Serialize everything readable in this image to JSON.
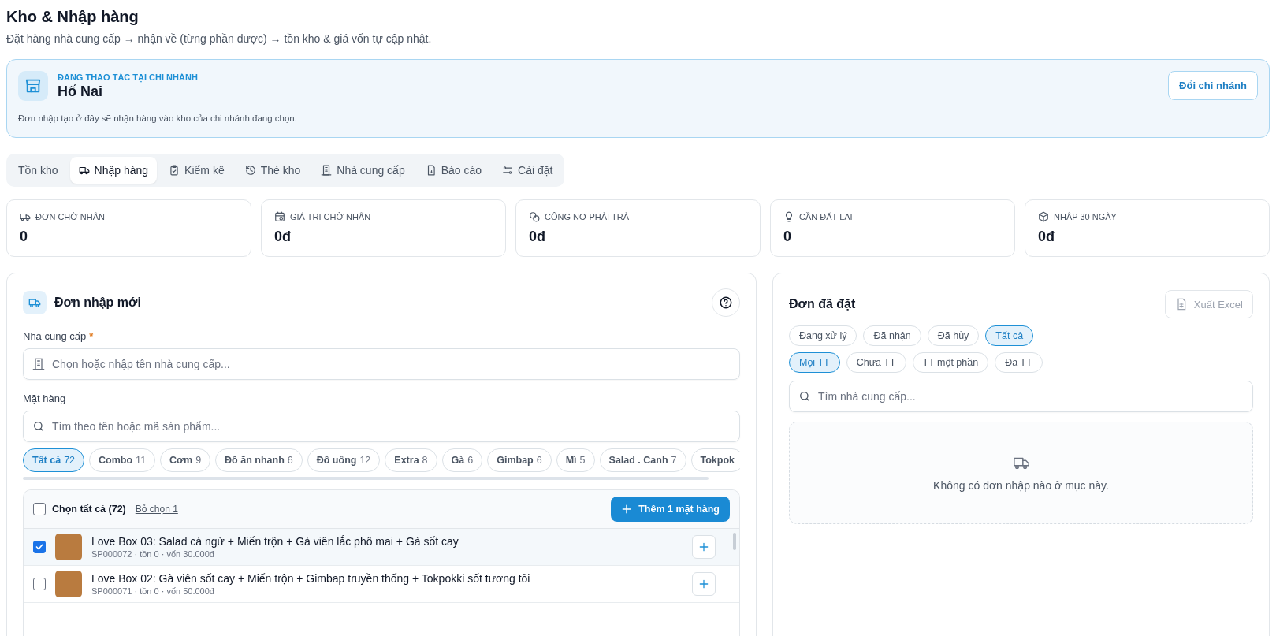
{
  "page": {
    "title": "Kho & Nhập hàng",
    "subtitle": "Đặt hàng nhà cung cấp → nhận về (từng phần được) → tồn kho & giá vốn tự cập nhật."
  },
  "branch": {
    "label": "ĐANG THAO TÁC TẠI CHI NHÁNH",
    "name": "Hố Nai",
    "note": "Đơn nhập tạo ở đây sẽ nhận hàng vào kho của chi nhánh đang chọn.",
    "button": "Đổi chi nhánh"
  },
  "tabs": [
    {
      "label": "Tồn kho",
      "selected": false
    },
    {
      "label": "Nhập hàng",
      "selected": true
    },
    {
      "label": "Kiểm kê",
      "selected": false
    },
    {
      "label": "Thẻ kho",
      "selected": false
    },
    {
      "label": "Nhà cung cấp",
      "selected": false
    },
    {
      "label": "Báo cáo",
      "selected": false
    },
    {
      "label": "Cài đặt",
      "selected": false
    }
  ],
  "stats": [
    {
      "label": "ĐƠN CHỜ NHẬN",
      "value": "0"
    },
    {
      "label": "GIÁ TRỊ CHỜ NHẬN",
      "value": "0đ"
    },
    {
      "label": "CÔNG NỢ PHẢI TRẢ",
      "value": "0đ"
    },
    {
      "label": "CẦN ĐẶT LẠI",
      "value": "0"
    },
    {
      "label": "NHẬP 30 NGÀY",
      "value": "0đ"
    }
  ],
  "new_order": {
    "title": "Đơn nhập mới",
    "supplier_label": "Nhà cung cấp",
    "required_mark": "*",
    "supplier_placeholder": "Chọn hoặc nhập tên nhà cung cấp...",
    "items_label": "Mặt hàng",
    "search_placeholder": "Tìm theo tên hoặc mã sản phẩm...",
    "categories": [
      {
        "name": "Tất cả",
        "count": "72",
        "selected": true
      },
      {
        "name": "Combo",
        "count": "11",
        "selected": false
      },
      {
        "name": "Cơm",
        "count": "9",
        "selected": false
      },
      {
        "name": "Đồ ăn nhanh",
        "count": "6",
        "selected": false
      },
      {
        "name": "Đồ uống",
        "count": "12",
        "selected": false
      },
      {
        "name": "Extra",
        "count": "8",
        "selected": false
      },
      {
        "name": "Gà",
        "count": "6",
        "selected": false
      },
      {
        "name": "Gimbap",
        "count": "6",
        "selected": false
      },
      {
        "name": "Mì",
        "count": "5",
        "selected": false
      },
      {
        "name": "Salad . Canh",
        "count": "7",
        "selected": false
      },
      {
        "name": "Tokpok",
        "selected": false
      }
    ],
    "select_all": {
      "label": "Chọn tất cả (72)",
      "checked": false
    },
    "deselect_link": "Bỏ chọn 1",
    "add_button": "Thêm 1 mặt hàng",
    "items": [
      {
        "name": "Love Box 03: Salad cá ngừ + Miến trộn + Gà viên lắc phô mai + Gà sốt cay",
        "meta": "SP000072 · tồn 0 · vốn 30.000đ",
        "checked": true
      },
      {
        "name": "Love Box 02: Gà viên sốt cay + Miến trộn + Gimbap truyền thống + Tokpokki sốt tương tỏi",
        "meta": "SP000071 · tồn 0 · vốn 50.000đ",
        "checked": false
      }
    ]
  },
  "orders": {
    "title": "Đơn đã đặt",
    "export_button": {
      "label": "Xuất Excel",
      "disabled": true
    },
    "status_filters": [
      {
        "label": "Đang xử lý",
        "selected": false
      },
      {
        "label": "Đã nhận",
        "selected": false
      },
      {
        "label": "Đã hủy",
        "selected": false
      },
      {
        "label": "Tất cả",
        "selected": true
      }
    ],
    "payment_filters": [
      {
        "label": "Mọi TT",
        "selected": true
      },
      {
        "label": "Chưa TT",
        "selected": false
      },
      {
        "label": "TT một phần",
        "selected": false
      },
      {
        "label": "Đã TT",
        "selected": false
      }
    ],
    "search_placeholder": "Tìm nhà cung cấp...",
    "empty_text": "Không có đơn nhập nào ở mục này."
  }
}
